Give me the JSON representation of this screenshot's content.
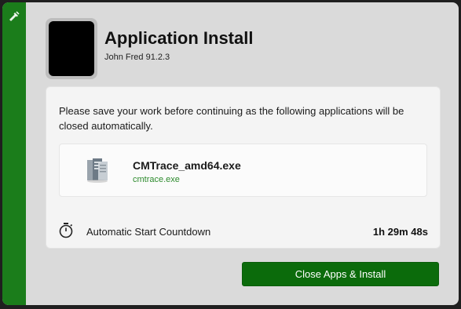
{
  "window": {
    "title": "Application Install",
    "subtitle": "John Fred 91.2.3"
  },
  "colors": {
    "accent": "#1b7d1b",
    "button": "#0b6b0b",
    "process_text": "#2e8b2e"
  },
  "message": "Please save your work before continuing as the following applications will be closed automatically.",
  "apps": [
    {
      "name": "CMTrace_amd64.exe",
      "process": "cmtrace.exe",
      "icon": "server-tower-icon"
    }
  ],
  "countdown": {
    "label": "Automatic Start Countdown",
    "value": "1h 29m 48s",
    "icon": "stopwatch-icon"
  },
  "actions": {
    "primary_label": "Close Apps & Install"
  }
}
